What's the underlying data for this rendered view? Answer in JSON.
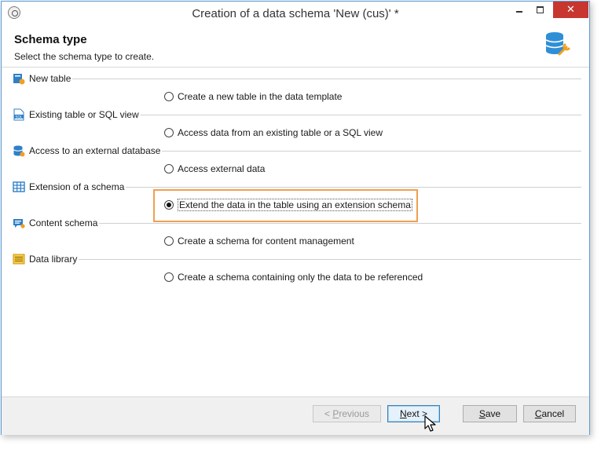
{
  "window": {
    "title": "Creation of a data schema 'New (cus)' *",
    "close_glyph": "✕"
  },
  "header": {
    "title": "Schema type",
    "subtitle": "Select the schema type to create.",
    "icon": "database-wrench-icon"
  },
  "groups": [
    {
      "label": "New table",
      "icon": "new-table-icon",
      "option": "Create a new table in the data template",
      "selected": false
    },
    {
      "label": "Existing table or SQL view",
      "icon": "sql-icon",
      "option": "Access data from an existing table or a SQL view",
      "selected": false
    },
    {
      "label": "Access to an external database",
      "icon": "external-database-icon",
      "option": "Access external data",
      "selected": false
    },
    {
      "label": "Extension of a schema",
      "icon": "grid-icon",
      "option": "Extend the data in the table using an extension schema",
      "selected": true
    },
    {
      "label": "Content schema",
      "icon": "content-icon",
      "option": "Create a schema for content management",
      "selected": false
    },
    {
      "label": "Data library",
      "icon": "library-icon",
      "option": "Create a schema containing only the data to be referenced",
      "selected": false
    }
  ],
  "footer": {
    "previous": {
      "prefix": "< ",
      "mnemonic": "P",
      "rest": "revious",
      "enabled": false
    },
    "next": {
      "mnemonic": "N",
      "rest": "ext >",
      "enabled": true
    },
    "save": {
      "mnemonic": "S",
      "rest": "ave",
      "enabled": true
    },
    "cancel": {
      "mnemonic": "C",
      "rest": "ancel",
      "enabled": true
    }
  },
  "colors": {
    "highlight": "#f0a050",
    "accent": "#3c7fb1",
    "close": "#c7372f"
  }
}
